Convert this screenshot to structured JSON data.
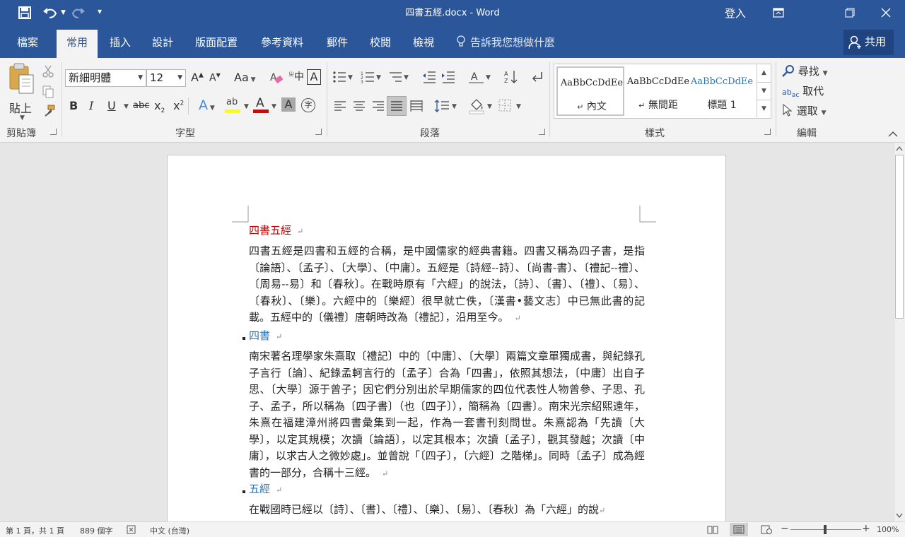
{
  "window": {
    "title": "四書五經.docx - Word",
    "signin": "登入",
    "controls": {
      "ribbon_display": "ribbon-display-icon",
      "restore": "restore-icon",
      "close": "close-icon"
    }
  },
  "qat": {
    "save": "save-icon",
    "undo": "undo-icon",
    "redo": "redo-icon",
    "customize": "customize-icon"
  },
  "tabs": [
    "檔案",
    "常用",
    "插入",
    "設計",
    "版面配置",
    "參考資料",
    "郵件",
    "校閱",
    "檢視"
  ],
  "active_tab": "常用",
  "tell_me": "告訴我您想做什麼",
  "share": "共用",
  "groups": {
    "clipboard": {
      "label": "剪貼簿",
      "paste": "貼上"
    },
    "font": {
      "label": "字型",
      "font_name": "新細明體",
      "font_size": "12",
      "grow": "A",
      "shrink": "A",
      "case": "Aa",
      "bold": "B",
      "italic": "I",
      "underline": "U",
      "strike": "abc",
      "sub": "x",
      "sup": "x",
      "phonetic": "中",
      "phonetic_sup": "ㄓ",
      "border_char": "A",
      "text_effect": "A",
      "highlight_sub": "ab",
      "font_color": "A",
      "shade": "A",
      "enclose": "字"
    },
    "paragraph": {
      "label": "段落"
    },
    "styles": {
      "label": "樣式",
      "items": [
        {
          "sample": "AaBbCcDdEe",
          "name": "內文",
          "mark": "↵"
        },
        {
          "sample": "AaBbCcDdEe",
          "name": "無間距",
          "mark": "↵"
        },
        {
          "sample": "AaBbCcDdEe",
          "name": "標題 1"
        }
      ]
    },
    "editing": {
      "label": "編輯",
      "find": "尋找",
      "replace": "取代",
      "select": "選取"
    }
  },
  "document": {
    "title": "四書五經",
    "para1": "四書五經是四書和五經的合稱，是中國儒家的經典書籍。四書又稱為四子書，是指〔論語〕、〔孟子〕、〔大學〕、〔中庸〕。五經是〔詩經--詩〕、〔尚書-書〕、〔禮記--禮〕、〔周易--易〕和〔春秋〕。在戰時原有「六經」的說法，〔詩〕、〔書〕、〔禮〕、〔易〕、〔春秋〕、〔樂〕。六經中的〔樂經〕很早就亡佚，〔漢書•藝文志〕中已無此書的記載。五經中的〔儀禮〕唐朝時改為〔禮記〕，沿用至今。",
    "heading2": "四書",
    "para2": "南宋著名理學家朱熹取〔禮記〕中的〔中庸〕、〔大學〕兩篇文章單獨成書，與紀錄孔子言行〔論〕、紀錄孟軻言行的〔孟子〕合為「四書」，依照其想法，〔中庸〕出自子思、〔大學〕源于曾子；因它們分別出於早期儒家的四位代表性人物曾參、子思、孔子、孟子，所以稱為〔四子書〕（也〔四子〕），簡稱為〔四書〕。南宋光宗紹熙遠年，朱熹在福建漳州將四書彙集到一起，作為一套書刊刻問世。朱熹認為「先讀〔大學〕，以定其規模；次讀〔論語〕，以定其根本；次讀〔孟子〕，觀其發越；次讀〔中庸〕，以求古人之微妙處」。並曾說「〔四子〕，〔六經〕之階梯」。同時〔孟子〕成為經書的一部分，合稱十三經。",
    "heading3": "五經",
    "para3": "在戰國時已經以〔詩〕、〔書〕、〔禮〕、〔樂〕、〔易〕、〔春秋〕為「六經」的說",
    "mark": "↵"
  },
  "status": {
    "page": "第 1 頁，共 1 頁",
    "words": "889 個字",
    "language": "中文 (台灣)",
    "zoom": "100%",
    "zoom_minus": "−",
    "zoom_plus": "+"
  },
  "colors": {
    "brand": "#2b579a",
    "title_red": "#c00000",
    "heading_blue": "#2e74b5",
    "font_color_red": "#e00000",
    "highlight": "#ffff00"
  }
}
